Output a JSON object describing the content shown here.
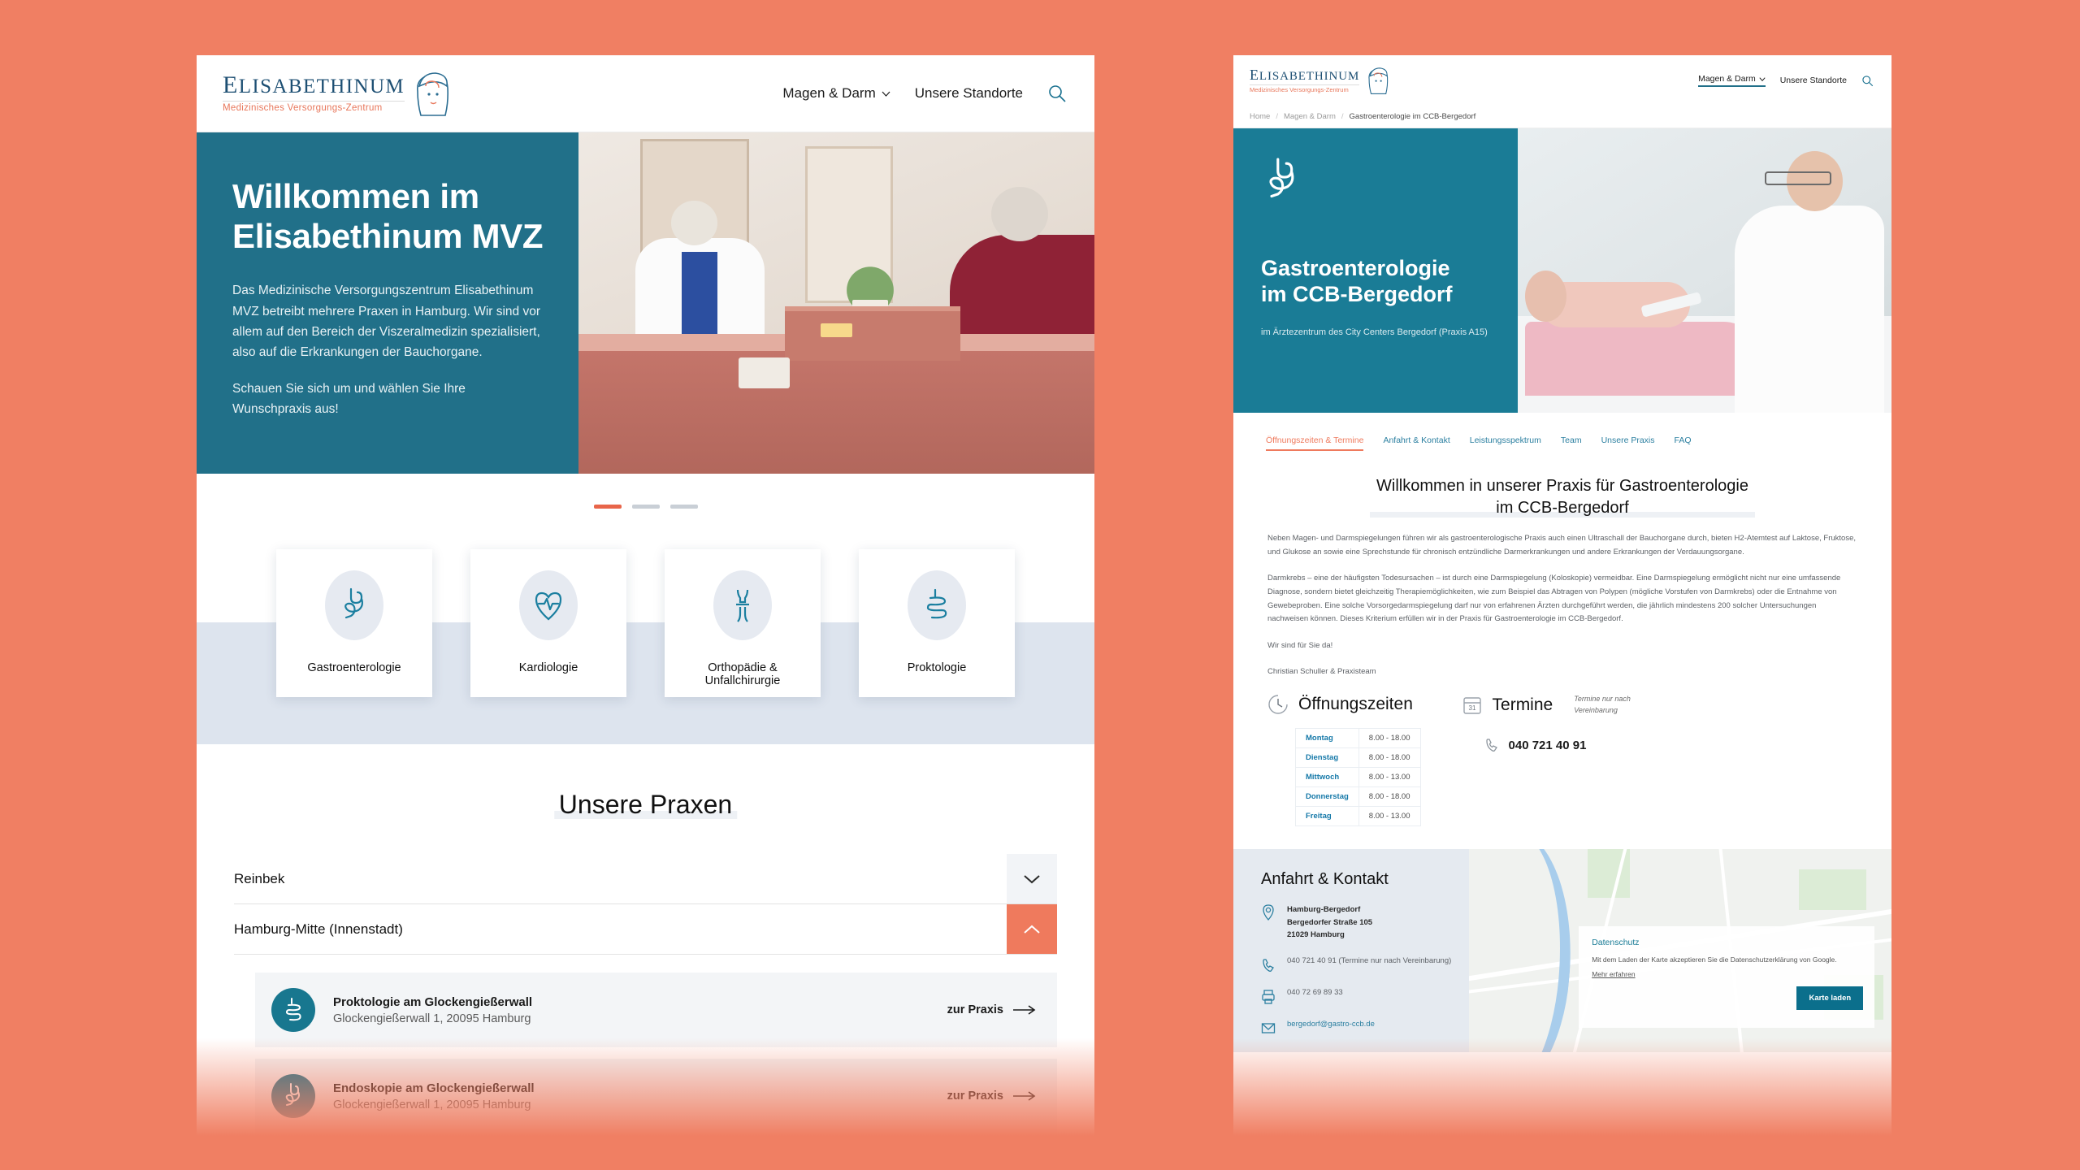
{
  "brand": {
    "name_lead": "E",
    "name_rest": "LISABETHINUM",
    "tagline": "Medizinisches Versorgungs-Zentrum"
  },
  "left": {
    "nav": [
      {
        "label": "Magen & Darm",
        "has_chevron": true
      },
      {
        "label": "Unsere Standorte",
        "has_chevron": false
      }
    ],
    "search_icon": "search-icon",
    "hero": {
      "title_line1": "Willkommen im",
      "title_line2": "Elisabethinum MVZ",
      "paragraph1": "Das Medizinische Versorgungszentrum Elisabethinum MVZ betreibt mehrere Praxen in Hamburg. Wir sind vor allem auf den Bereich der Viszeralmedizin spezialisiert, also auf die Erkrankungen der Bauchorgane.",
      "paragraph2": "Schauen Sie sich um und wählen Sie Ihre Wunschpraxis aus!"
    },
    "carousel": {
      "slides": 3,
      "active_index": 0
    },
    "cards": [
      {
        "label": "Gastroenterologie",
        "icon": "stomach-icon"
      },
      {
        "label": "Kardiologie",
        "icon": "heart-pulse-icon"
      },
      {
        "label": "Orthopädie & Unfallchirurgie",
        "icon": "bone-joint-icon"
      },
      {
        "label": "Proktologie",
        "icon": "intestine-icon"
      }
    ],
    "praxen": {
      "heading": "Unsere Praxen",
      "accordion": [
        {
          "label": "Reinbek",
          "expanded": false
        },
        {
          "label": "Hamburg-Mitte (Innenstadt)",
          "expanded": true
        }
      ],
      "items": [
        {
          "name": "Proktologie am Glockengießerwall",
          "address": "Glockengießerwall 1, 20095 Hamburg",
          "cta": "zur Praxis",
          "icon": "intestine-icon"
        },
        {
          "name": "Endoskopie am Glockengießerwall",
          "address": "Glockengießerwall 1, 20095 Hamburg",
          "cta": "zur Praxis",
          "icon": "stomach-icon"
        }
      ]
    }
  },
  "right": {
    "nav": [
      {
        "label": "Magen & Darm",
        "has_chevron": true,
        "active": true
      },
      {
        "label": "Unsere Standorte",
        "has_chevron": false,
        "active": false
      }
    ],
    "breadcrumb": [
      "Home",
      "Magen & Darm",
      "Gastroenterologie im CCB-Bergedorf"
    ],
    "hero": {
      "icon": "stomach-icon",
      "title_line1": "Gastroenterologie",
      "title_line2": "im CCB-Bergedorf",
      "subtitle": "im Ärztezentrum des City Centers Bergedorf (Praxis A15)"
    },
    "tabs": [
      {
        "label": "Öffnungszeiten & Termine",
        "active": true
      },
      {
        "label": "Anfahrt & Kontakt",
        "active": false
      },
      {
        "label": "Leistungsspektrum",
        "active": false
      },
      {
        "label": "Team",
        "active": false
      },
      {
        "label": "Unsere Praxis",
        "active": false
      },
      {
        "label": "FAQ",
        "active": false
      }
    ],
    "content": {
      "heading_line1": "Willkommen in unserer Praxis für Gastroenterologie",
      "heading_line2": "im  CCB-Bergedorf",
      "paragraph1": "Neben Magen- und Darmspiegelungen führen wir als gastroenterologische Praxis auch einen Ultraschall der Bauchorgane durch,  bieten H2-Atemtest auf Laktose, Fruktose, und Glukose an sowie eine Sprechstunde für chronisch entzündliche Darmerkrankungen und andere Erkrankungen der Verdauungsorgane.",
      "paragraph2": "Darmkrebs – eine der häufigsten Todesursachen – ist durch eine Darmspiegelung (Koloskopie) vermeidbar. Eine Darmspiegelung ermöglicht nicht nur eine umfassende Diagnose, sondern bietet gleichzeitig Therapiemöglichkeiten, wie zum Beispiel das Abtragen von Polypen (mögliche Vorstufen von Darmkrebs) oder die Entnahme von Gewebeproben. Eine solche Vorsorgedarmspiegelung darf nur von erfahrenen Ärzten durchgeführt werden, die jährlich mindestens 200 solcher Untersuchungen nachweisen können. Dieses Kriterium erfüllen wir in der Praxis für Gastroenterologie im CCB-Bergedorf.",
      "paragraph3": "Wir sind für Sie da!",
      "paragraph4": "Christian Schuller & Praxisteam"
    },
    "hours": {
      "title": "Öffnungszeiten",
      "icon": "clock-icon",
      "rows": [
        {
          "day": "Montag",
          "time": "8.00 - 18.00"
        },
        {
          "day": "Dienstag",
          "time": "8.00 - 18.00"
        },
        {
          "day": "Mittwoch",
          "time": "8.00 - 13.00"
        },
        {
          "day": "Donnerstag",
          "time": "8.00 - 18.00"
        },
        {
          "day": "Freitag",
          "time": "8.00 - 13.00"
        }
      ]
    },
    "appointments": {
      "title": "Termine",
      "icon": "calendar-icon",
      "note": "Termine nur nach Vereinbarung",
      "phone": "040 721 40 91"
    },
    "contact": {
      "title": "Anfahrt & Kontakt",
      "address_line1": "Hamburg-Bergedorf",
      "address_line2": "Bergedorfer Straße 105",
      "address_line3": "21029 Hamburg",
      "phone": "040 721 40 91 (Termine nur nach Vereinbarung)",
      "fax": "040 72 69 89 33",
      "email": "bergedorf@gastro-ccb.de"
    },
    "privacy": {
      "title": "Datenschutz",
      "text": "Mit dem Laden der Karte akzeptieren Sie die Datenschutzerklärung von Google.",
      "link": "Mehr erfahren",
      "button": "Karte laden"
    }
  },
  "colors": {
    "background": "#f07f63",
    "teal": "#217089",
    "teal_dark": "#18778f",
    "coral": "#ef7a5d",
    "band": "#dde4ee",
    "link_blue": "#2b7fa0"
  }
}
